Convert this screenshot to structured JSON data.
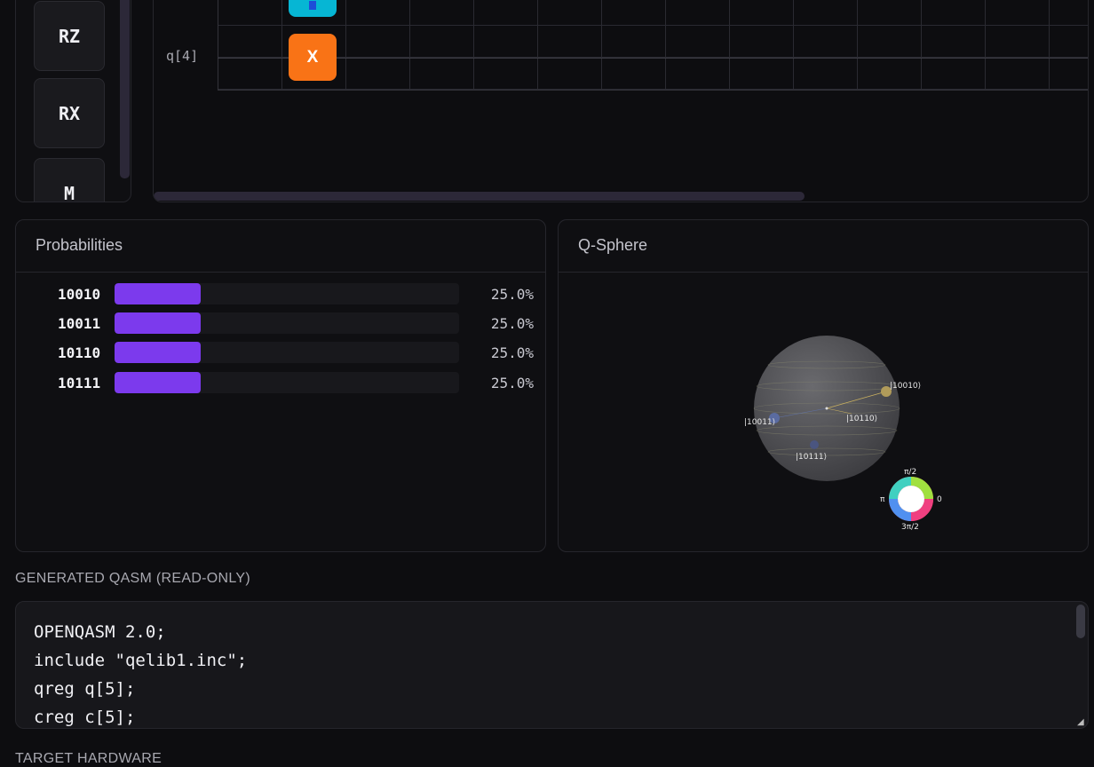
{
  "palette": {
    "gates": [
      "RZ",
      "RX",
      "M"
    ]
  },
  "circuit": {
    "qubit_label": "q[4]",
    "x_gate_label": "X"
  },
  "probabilities": {
    "title": "Probabilities",
    "rows": [
      {
        "state": "10010",
        "percent": "25.0%",
        "fraction": 0.25
      },
      {
        "state": "10011",
        "percent": "25.0%",
        "fraction": 0.25
      },
      {
        "state": "10110",
        "percent": "25.0%",
        "fraction": 0.25
      },
      {
        "state": "10111",
        "percent": "25.0%",
        "fraction": 0.25
      }
    ],
    "bar_color": "#7c3aed"
  },
  "qsphere": {
    "title": "Q-Sphere",
    "states": [
      "|10010⟩",
      "|10011⟩",
      "|10110⟩",
      "|10111⟩"
    ],
    "phase_labels": {
      "top": "π/2",
      "left": "π",
      "right": "0",
      "bottom": "3π/2"
    }
  },
  "qasm": {
    "section_label": "GENERATED QASM (READ-ONLY)",
    "lines": [
      "OPENQASM 2.0;",
      "include \"qelib1.inc\";",
      "qreg q[5];",
      "creg c[5];"
    ]
  },
  "next_section_label": "TARGET HARDWARE",
  "colors": {
    "x_gate": "#f97316",
    "cyan_gate": "#06b6d4",
    "accent": "#7c3aed"
  }
}
